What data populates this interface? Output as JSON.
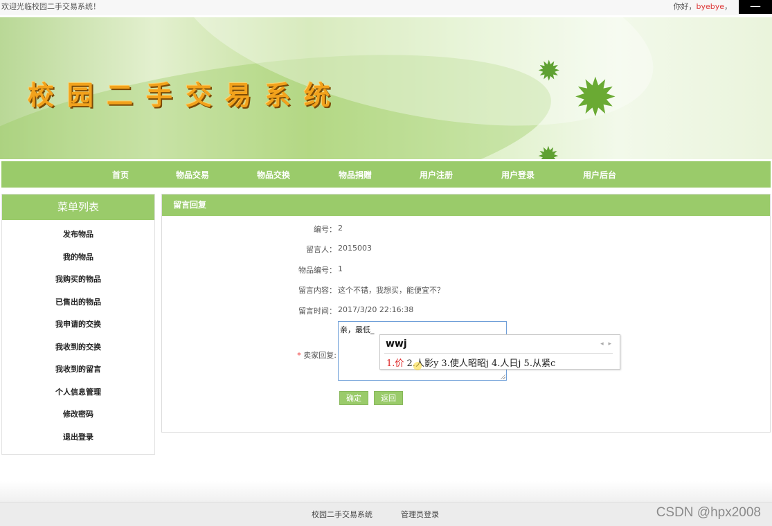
{
  "topbar": {
    "welcome": "欢迎光临校园二手交易系统！",
    "greeting": "你好，",
    "username": "byebye",
    "greeting_suffix": "，",
    "window_button": "—"
  },
  "banner": {
    "title": "校园二手交易系统"
  },
  "nav": {
    "items": [
      "首页",
      "物品交易",
      "物品交换",
      "物品捐赠",
      "用户注册",
      "用户登录",
      "用户后台"
    ]
  },
  "sidebar": {
    "title": "菜单列表",
    "items": [
      "发布物品",
      "我的物品",
      "我购买的物品",
      "已售出的物品",
      "我申请的交换",
      "我收到的交换",
      "我收到的留言",
      "个人信息管理",
      "修改密码",
      "退出登录"
    ]
  },
  "panel": {
    "title": "留言回复",
    "fields": [
      {
        "label": "编号：",
        "value": "2"
      },
      {
        "label": "留言人：",
        "value": "2015003"
      },
      {
        "label": "物品编号：",
        "value": "1"
      },
      {
        "label": "留言内容：",
        "value": "这个不错，我想买，能便宜不？"
      },
      {
        "label": "留言时间：",
        "value": "2017/3/20 22:16:38"
      }
    ],
    "reply_required_mark": "*",
    "reply_label": "卖家回复:",
    "reply_value": "亲，最低_",
    "confirm_button": "确定",
    "back_button": "返回"
  },
  "ime": {
    "composition": "wwj",
    "arrows": "◂ ▸",
    "candidates": {
      "first": "1.价",
      "rest": " 2.人影y 3.使人昭昭j 4.人日j 5.从紧c"
    }
  },
  "footer": {
    "system_link": "校园二手交易系统",
    "admin_link": "管理员登录",
    "watermark": "CSDN @hpx2008"
  }
}
